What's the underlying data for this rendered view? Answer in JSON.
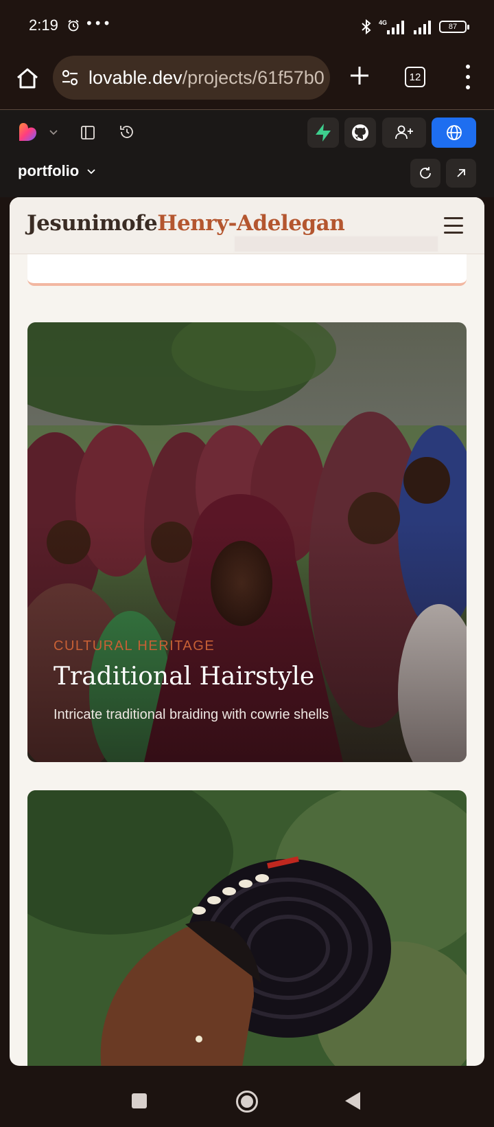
{
  "status_bar": {
    "time": "2:19",
    "more": "•••",
    "network": "4G",
    "battery": "87"
  },
  "browser": {
    "url_domain": "lovable.dev",
    "url_path": "/projects/61f57b0",
    "tab_count": "12"
  },
  "lovable": {
    "project_name": "portfolio",
    "publish_color": "#1e6ef0"
  },
  "site": {
    "brand_first": "Jesunimofe",
    "brand_last": "Henry-Adelegan",
    "brand_first_color": "#3a2c24",
    "brand_last_color": "#b4562f"
  },
  "cards": [
    {
      "category": "CULTURAL HERITAGE",
      "title": "Traditional Hairstyle",
      "description": "Intricate traditional braiding with cowrie shells"
    }
  ]
}
